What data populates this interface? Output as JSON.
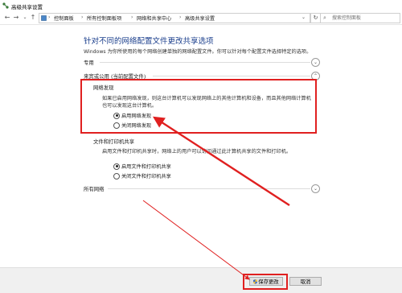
{
  "window": {
    "title": "高级共享设置"
  },
  "addressbar": {
    "crumbs": [
      "控制面板",
      "所有控制面板项",
      "网络和共享中心",
      "高级共享设置"
    ],
    "search_placeholder": "搜索控制面板"
  },
  "main": {
    "heading": "针对不同的网络配置文件更改共享选项",
    "subtitle": "Windows 为你所使用的每个网络创建单独的网络配置文件。你可以针对每个配置文件选择特定的选项。",
    "profiles": {
      "private": {
        "label": "专用"
      },
      "guest_public": {
        "label": "来宾或公用 (当前配置文件)"
      },
      "all": {
        "label": "所有网络"
      }
    },
    "network_discovery": {
      "title": "网络发现",
      "description": "如果已启用网络发现，则这台计算机可以发现网络上的其他计算机和设备，而且其他网络计算机也可以发现这台计算机。",
      "options": [
        "启用网络发现",
        "关闭网络发现"
      ],
      "selected": 0
    },
    "file_printer_sharing": {
      "title": "文件和打印机共享",
      "description": "启用文件和打印机共享时，网络上的用户可以访问通过此计算机共享的文件和打印机。",
      "options": [
        "启用文件和打印机共享",
        "关闭文件和打印机共享"
      ],
      "selected": 0
    }
  },
  "footer": {
    "save_label": "保存更改",
    "cancel_label": "取消"
  },
  "colors": {
    "highlight": "#e02020",
    "heading": "#1a3e8c"
  }
}
